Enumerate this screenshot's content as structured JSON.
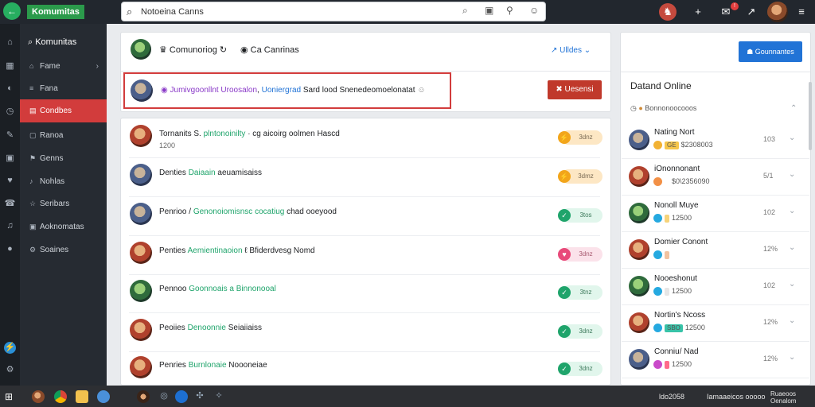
{
  "app": {
    "brand": "Komumitas"
  },
  "search": {
    "value": "Notoeina Canns"
  },
  "sidebar": {
    "header": "Komunitas",
    "items": [
      {
        "label": "Fame",
        "icon": "home-icon"
      },
      {
        "label": "Fana",
        "icon": "list-icon"
      },
      {
        "label": "Condbes",
        "icon": "group-icon",
        "active": true
      },
      {
        "label": "Ranoa",
        "icon": "chat-icon"
      },
      {
        "label": "Genns",
        "icon": "flag-icon"
      },
      {
        "label": "Nohlas",
        "icon": "bell-icon"
      },
      {
        "label": "Seribars",
        "icon": "star-icon"
      },
      {
        "label": "Aoknomatas",
        "icon": "calendar-icon"
      },
      {
        "label": "Soaines",
        "icon": "settings-icon"
      }
    ]
  },
  "header_card": {
    "community_a": "Comunoriog",
    "community_b": "Ca Canrinas",
    "filter_label": "Ulldes",
    "message": {
      "part1": "Jumivgoonllnt Uroosalon",
      "part2": "Uoniergrad",
      "part3": "Sard lood Snenedeomoelonatat"
    },
    "action_label": "Uesensi"
  },
  "feed": [
    {
      "name": "Tornanits S.",
      "highlight": "plntonoinilty",
      "rest": "· cg aicoirg oolmen Hascd",
      "sub": "1200",
      "badge": "3dnz",
      "style": "amber",
      "icon": "⚡"
    },
    {
      "name": "Denties",
      "highlight": "Daiaain",
      "rest": "aeuamisaiss",
      "sub": "",
      "badge": "3dmz",
      "style": "amber",
      "icon": "⚡"
    },
    {
      "name": "Penrioo /",
      "highlight": "Genonoiomisnsc cocatiug",
      "rest": "chad ooeyood",
      "sub": "",
      "badge": "3tos",
      "style": "mint",
      "icon": "✓"
    },
    {
      "name": "Penties",
      "highlight": "Aemientinaoion",
      "rest": "ℓ Bfiderdvesg Nomd",
      "sub": "",
      "badge": "3dnz",
      "style": "pink",
      "icon": "♥"
    },
    {
      "name": "Pennoo",
      "highlight": "Goonnoais a Binnonooal",
      "rest": "",
      "sub": "",
      "badge": "3tnz",
      "style": "mint",
      "icon": "✓"
    },
    {
      "name": "Peoiies",
      "highlight": "Denoonnie",
      "rest": "Seiaiiaiss",
      "sub": "",
      "badge": "3dnz",
      "style": "mint",
      "icon": "✓"
    },
    {
      "name": "Penries",
      "highlight": "Burnlonaie",
      "rest": "Noooneiae",
      "sub": "",
      "badge": "3dnz",
      "style": "mint",
      "icon": "✓"
    }
  ],
  "right": {
    "primary_button": "Gounnantes",
    "panel_title": "Datand Online",
    "filter": "Bonnonoocooos",
    "people": [
      {
        "name": "Nating Nort",
        "tag": "GE",
        "sub": "$2308003",
        "val": "103",
        "b": "#f2b233",
        "t": "#f6c64a"
      },
      {
        "name": "iOnonnonant",
        "tag": "",
        "sub": "$0\\2356090",
        "val": "5/1",
        "b": "#f29046",
        "t": "#ffffff"
      },
      {
        "name": "Nonoll Muye",
        "tag": "",
        "sub": "12500",
        "val": "102",
        "b": "#25a9e0",
        "t": "#f6d37a"
      },
      {
        "name": "Domier Conont",
        "tag": "",
        "sub": "",
        "val": "12%",
        "b": "#25a9e0",
        "t": "#f2c2a0"
      },
      {
        "name": "Nooeshonut",
        "tag": "",
        "sub": "12500",
        "val": "102",
        "b": "#25a9e0",
        "t": "#e6e6e6"
      },
      {
        "name": "Nortin's Ncoss",
        "tag": "SBO",
        "sub": "12500",
        "val": "12%",
        "b": "#25a9e0",
        "t": "#38c3a8"
      },
      {
        "name": "Conniu/ Nad",
        "tag": "",
        "sub": "12500",
        "val": "12%",
        "b": "#c94ac9",
        "t": "#ff6b8a"
      }
    ]
  },
  "taskbar": {
    "status_1": "ldo2058",
    "status_2": "Iamaaeicos ooooo",
    "status_3": "Ruaeoos Oenalom"
  },
  "colors": {
    "accent": "#d23c3c",
    "primary": "#2173d6",
    "brand": "#2b9a4b"
  }
}
